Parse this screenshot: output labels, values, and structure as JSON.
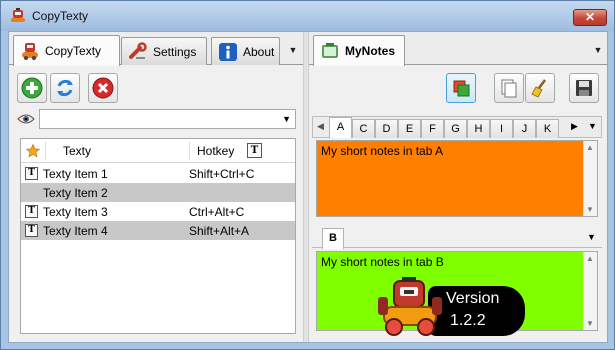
{
  "window": {
    "title": "CopyTexty",
    "close_glyph": "✕"
  },
  "left_tabs": [
    {
      "label": "CopyTexty",
      "icon": "robot-icon"
    },
    {
      "label": "Settings",
      "icon": "wrench-icon"
    },
    {
      "label": "About",
      "icon": "info-icon"
    }
  ],
  "toolbar_left": {
    "add": "add-icon",
    "refresh": "refresh-icon",
    "delete": "delete-icon"
  },
  "filter": {
    "icon": "eye-icon",
    "value": ""
  },
  "list": {
    "columns": {
      "name": "Texty",
      "hotkey": "Hotkey"
    },
    "rows": [
      {
        "name": "Texty Item 1",
        "hotkey": "Shift+Ctrl+C",
        "has_icon": true,
        "selected": false
      },
      {
        "name": "Texty Item 2",
        "hotkey": "",
        "has_icon": false,
        "selected": true
      },
      {
        "name": "Texty Item 3",
        "hotkey": "Ctrl+Alt+C",
        "has_icon": true,
        "selected": false
      },
      {
        "name": "Texty Item 4",
        "hotkey": "Shift+Alt+A",
        "has_icon": true,
        "selected": true
      }
    ]
  },
  "right_tab": {
    "label": "MyNotes",
    "icon": "notes-icon"
  },
  "toolbar_right": [
    "layout-icon",
    "copy-icon",
    "broom-icon",
    "save-icon"
  ],
  "letter_tabs": [
    "A",
    "C",
    "D",
    "E",
    "F",
    "G",
    "H",
    "I",
    "J",
    "K"
  ],
  "active_letter": "A",
  "notes": {
    "top": {
      "text": "My short notes in tab A",
      "color": "#ff8000"
    },
    "bottom_tab": "B",
    "bottom": {
      "text": "My short notes in tab B",
      "color": "#80ff00"
    }
  },
  "version": {
    "line1": "Version",
    "line2": "1.2.2"
  },
  "colors": {
    "selection": "#c8c8c8",
    "window_frame": "#a9c4e3"
  }
}
